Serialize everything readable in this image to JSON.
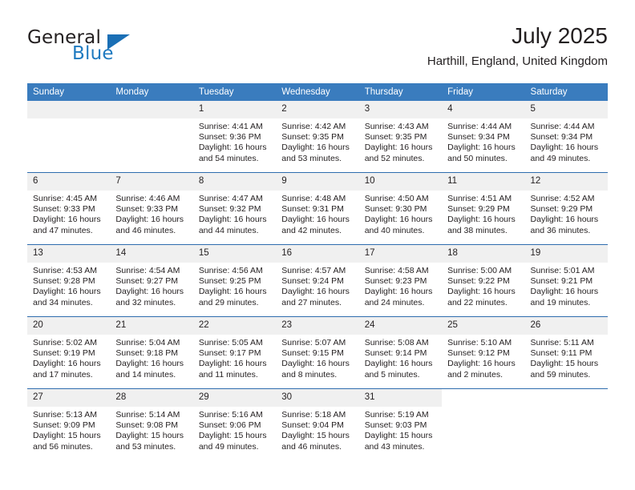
{
  "brand": {
    "name_part1": "General",
    "name_part2": "Blue",
    "logo_icon": "blue-triangle-logo"
  },
  "header": {
    "title": "July 2025",
    "location": "Harthill, England, United Kingdom"
  },
  "weekday_headers": [
    "Sunday",
    "Monday",
    "Tuesday",
    "Wednesday",
    "Thursday",
    "Friday",
    "Saturday"
  ],
  "colors": {
    "header_blue": "#3a7cbe",
    "row_divider_blue": "#2e6cae",
    "daynum_band": "#f0f0f0",
    "brand_blue": "#1f7ac0",
    "text": "#231f20"
  },
  "weeks": [
    [
      {
        "day": "",
        "sunrise": "",
        "sunset": "",
        "daylight_line1": "",
        "daylight_line2": ""
      },
      {
        "day": "",
        "sunrise": "",
        "sunset": "",
        "daylight_line1": "",
        "daylight_line2": ""
      },
      {
        "day": "1",
        "sunrise": "Sunrise: 4:41 AM",
        "sunset": "Sunset: 9:36 PM",
        "daylight_line1": "Daylight: 16 hours",
        "daylight_line2": "and 54 minutes."
      },
      {
        "day": "2",
        "sunrise": "Sunrise: 4:42 AM",
        "sunset": "Sunset: 9:35 PM",
        "daylight_line1": "Daylight: 16 hours",
        "daylight_line2": "and 53 minutes."
      },
      {
        "day": "3",
        "sunrise": "Sunrise: 4:43 AM",
        "sunset": "Sunset: 9:35 PM",
        "daylight_line1": "Daylight: 16 hours",
        "daylight_line2": "and 52 minutes."
      },
      {
        "day": "4",
        "sunrise": "Sunrise: 4:44 AM",
        "sunset": "Sunset: 9:34 PM",
        "daylight_line1": "Daylight: 16 hours",
        "daylight_line2": "and 50 minutes."
      },
      {
        "day": "5",
        "sunrise": "Sunrise: 4:44 AM",
        "sunset": "Sunset: 9:34 PM",
        "daylight_line1": "Daylight: 16 hours",
        "daylight_line2": "and 49 minutes."
      }
    ],
    [
      {
        "day": "6",
        "sunrise": "Sunrise: 4:45 AM",
        "sunset": "Sunset: 9:33 PM",
        "daylight_line1": "Daylight: 16 hours",
        "daylight_line2": "and 47 minutes."
      },
      {
        "day": "7",
        "sunrise": "Sunrise: 4:46 AM",
        "sunset": "Sunset: 9:33 PM",
        "daylight_line1": "Daylight: 16 hours",
        "daylight_line2": "and 46 minutes."
      },
      {
        "day": "8",
        "sunrise": "Sunrise: 4:47 AM",
        "sunset": "Sunset: 9:32 PM",
        "daylight_line1": "Daylight: 16 hours",
        "daylight_line2": "and 44 minutes."
      },
      {
        "day": "9",
        "sunrise": "Sunrise: 4:48 AM",
        "sunset": "Sunset: 9:31 PM",
        "daylight_line1": "Daylight: 16 hours",
        "daylight_line2": "and 42 minutes."
      },
      {
        "day": "10",
        "sunrise": "Sunrise: 4:50 AM",
        "sunset": "Sunset: 9:30 PM",
        "daylight_line1": "Daylight: 16 hours",
        "daylight_line2": "and 40 minutes."
      },
      {
        "day": "11",
        "sunrise": "Sunrise: 4:51 AM",
        "sunset": "Sunset: 9:29 PM",
        "daylight_line1": "Daylight: 16 hours",
        "daylight_line2": "and 38 minutes."
      },
      {
        "day": "12",
        "sunrise": "Sunrise: 4:52 AM",
        "sunset": "Sunset: 9:29 PM",
        "daylight_line1": "Daylight: 16 hours",
        "daylight_line2": "and 36 minutes."
      }
    ],
    [
      {
        "day": "13",
        "sunrise": "Sunrise: 4:53 AM",
        "sunset": "Sunset: 9:28 PM",
        "daylight_line1": "Daylight: 16 hours",
        "daylight_line2": "and 34 minutes."
      },
      {
        "day": "14",
        "sunrise": "Sunrise: 4:54 AM",
        "sunset": "Sunset: 9:27 PM",
        "daylight_line1": "Daylight: 16 hours",
        "daylight_line2": "and 32 minutes."
      },
      {
        "day": "15",
        "sunrise": "Sunrise: 4:56 AM",
        "sunset": "Sunset: 9:25 PM",
        "daylight_line1": "Daylight: 16 hours",
        "daylight_line2": "and 29 minutes."
      },
      {
        "day": "16",
        "sunrise": "Sunrise: 4:57 AM",
        "sunset": "Sunset: 9:24 PM",
        "daylight_line1": "Daylight: 16 hours",
        "daylight_line2": "and 27 minutes."
      },
      {
        "day": "17",
        "sunrise": "Sunrise: 4:58 AM",
        "sunset": "Sunset: 9:23 PM",
        "daylight_line1": "Daylight: 16 hours",
        "daylight_line2": "and 24 minutes."
      },
      {
        "day": "18",
        "sunrise": "Sunrise: 5:00 AM",
        "sunset": "Sunset: 9:22 PM",
        "daylight_line1": "Daylight: 16 hours",
        "daylight_line2": "and 22 minutes."
      },
      {
        "day": "19",
        "sunrise": "Sunrise: 5:01 AM",
        "sunset": "Sunset: 9:21 PM",
        "daylight_line1": "Daylight: 16 hours",
        "daylight_line2": "and 19 minutes."
      }
    ],
    [
      {
        "day": "20",
        "sunrise": "Sunrise: 5:02 AM",
        "sunset": "Sunset: 9:19 PM",
        "daylight_line1": "Daylight: 16 hours",
        "daylight_line2": "and 17 minutes."
      },
      {
        "day": "21",
        "sunrise": "Sunrise: 5:04 AM",
        "sunset": "Sunset: 9:18 PM",
        "daylight_line1": "Daylight: 16 hours",
        "daylight_line2": "and 14 minutes."
      },
      {
        "day": "22",
        "sunrise": "Sunrise: 5:05 AM",
        "sunset": "Sunset: 9:17 PM",
        "daylight_line1": "Daylight: 16 hours",
        "daylight_line2": "and 11 minutes."
      },
      {
        "day": "23",
        "sunrise": "Sunrise: 5:07 AM",
        "sunset": "Sunset: 9:15 PM",
        "daylight_line1": "Daylight: 16 hours",
        "daylight_line2": "and 8 minutes."
      },
      {
        "day": "24",
        "sunrise": "Sunrise: 5:08 AM",
        "sunset": "Sunset: 9:14 PM",
        "daylight_line1": "Daylight: 16 hours",
        "daylight_line2": "and 5 minutes."
      },
      {
        "day": "25",
        "sunrise": "Sunrise: 5:10 AM",
        "sunset": "Sunset: 9:12 PM",
        "daylight_line1": "Daylight: 16 hours",
        "daylight_line2": "and 2 minutes."
      },
      {
        "day": "26",
        "sunrise": "Sunrise: 5:11 AM",
        "sunset": "Sunset: 9:11 PM",
        "daylight_line1": "Daylight: 15 hours",
        "daylight_line2": "and 59 minutes."
      }
    ],
    [
      {
        "day": "27",
        "sunrise": "Sunrise: 5:13 AM",
        "sunset": "Sunset: 9:09 PM",
        "daylight_line1": "Daylight: 15 hours",
        "daylight_line2": "and 56 minutes."
      },
      {
        "day": "28",
        "sunrise": "Sunrise: 5:14 AM",
        "sunset": "Sunset: 9:08 PM",
        "daylight_line1": "Daylight: 15 hours",
        "daylight_line2": "and 53 minutes."
      },
      {
        "day": "29",
        "sunrise": "Sunrise: 5:16 AM",
        "sunset": "Sunset: 9:06 PM",
        "daylight_line1": "Daylight: 15 hours",
        "daylight_line2": "and 49 minutes."
      },
      {
        "day": "30",
        "sunrise": "Sunrise: 5:18 AM",
        "sunset": "Sunset: 9:04 PM",
        "daylight_line1": "Daylight: 15 hours",
        "daylight_line2": "and 46 minutes."
      },
      {
        "day": "31",
        "sunrise": "Sunrise: 5:19 AM",
        "sunset": "Sunset: 9:03 PM",
        "daylight_line1": "Daylight: 15 hours",
        "daylight_line2": "and 43 minutes."
      },
      {
        "day": "",
        "sunrise": "",
        "sunset": "",
        "daylight_line1": "",
        "daylight_line2": ""
      },
      {
        "day": "",
        "sunrise": "",
        "sunset": "",
        "daylight_line1": "",
        "daylight_line2": ""
      }
    ]
  ]
}
